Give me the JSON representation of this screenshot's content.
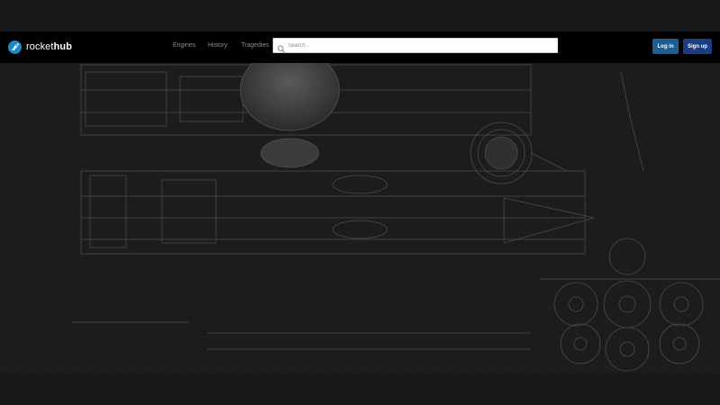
{
  "brand": {
    "name_light": "rocket",
    "name_bold": "hub",
    "icon": "rocket-icon",
    "accent": "#1f86c8"
  },
  "nav": {
    "links": [
      {
        "label": "Engines"
      },
      {
        "label": "History"
      },
      {
        "label": "Tragedies"
      }
    ]
  },
  "search": {
    "placeholder": "Search...",
    "value": "",
    "icon": "search-icon"
  },
  "auth": {
    "login_label": "Log in",
    "signup_label": "Sign up",
    "login_color": "#1d5f92",
    "signup_color": "#1b3d86"
  },
  "hero": {
    "image": "rocket-blueprint-background"
  }
}
